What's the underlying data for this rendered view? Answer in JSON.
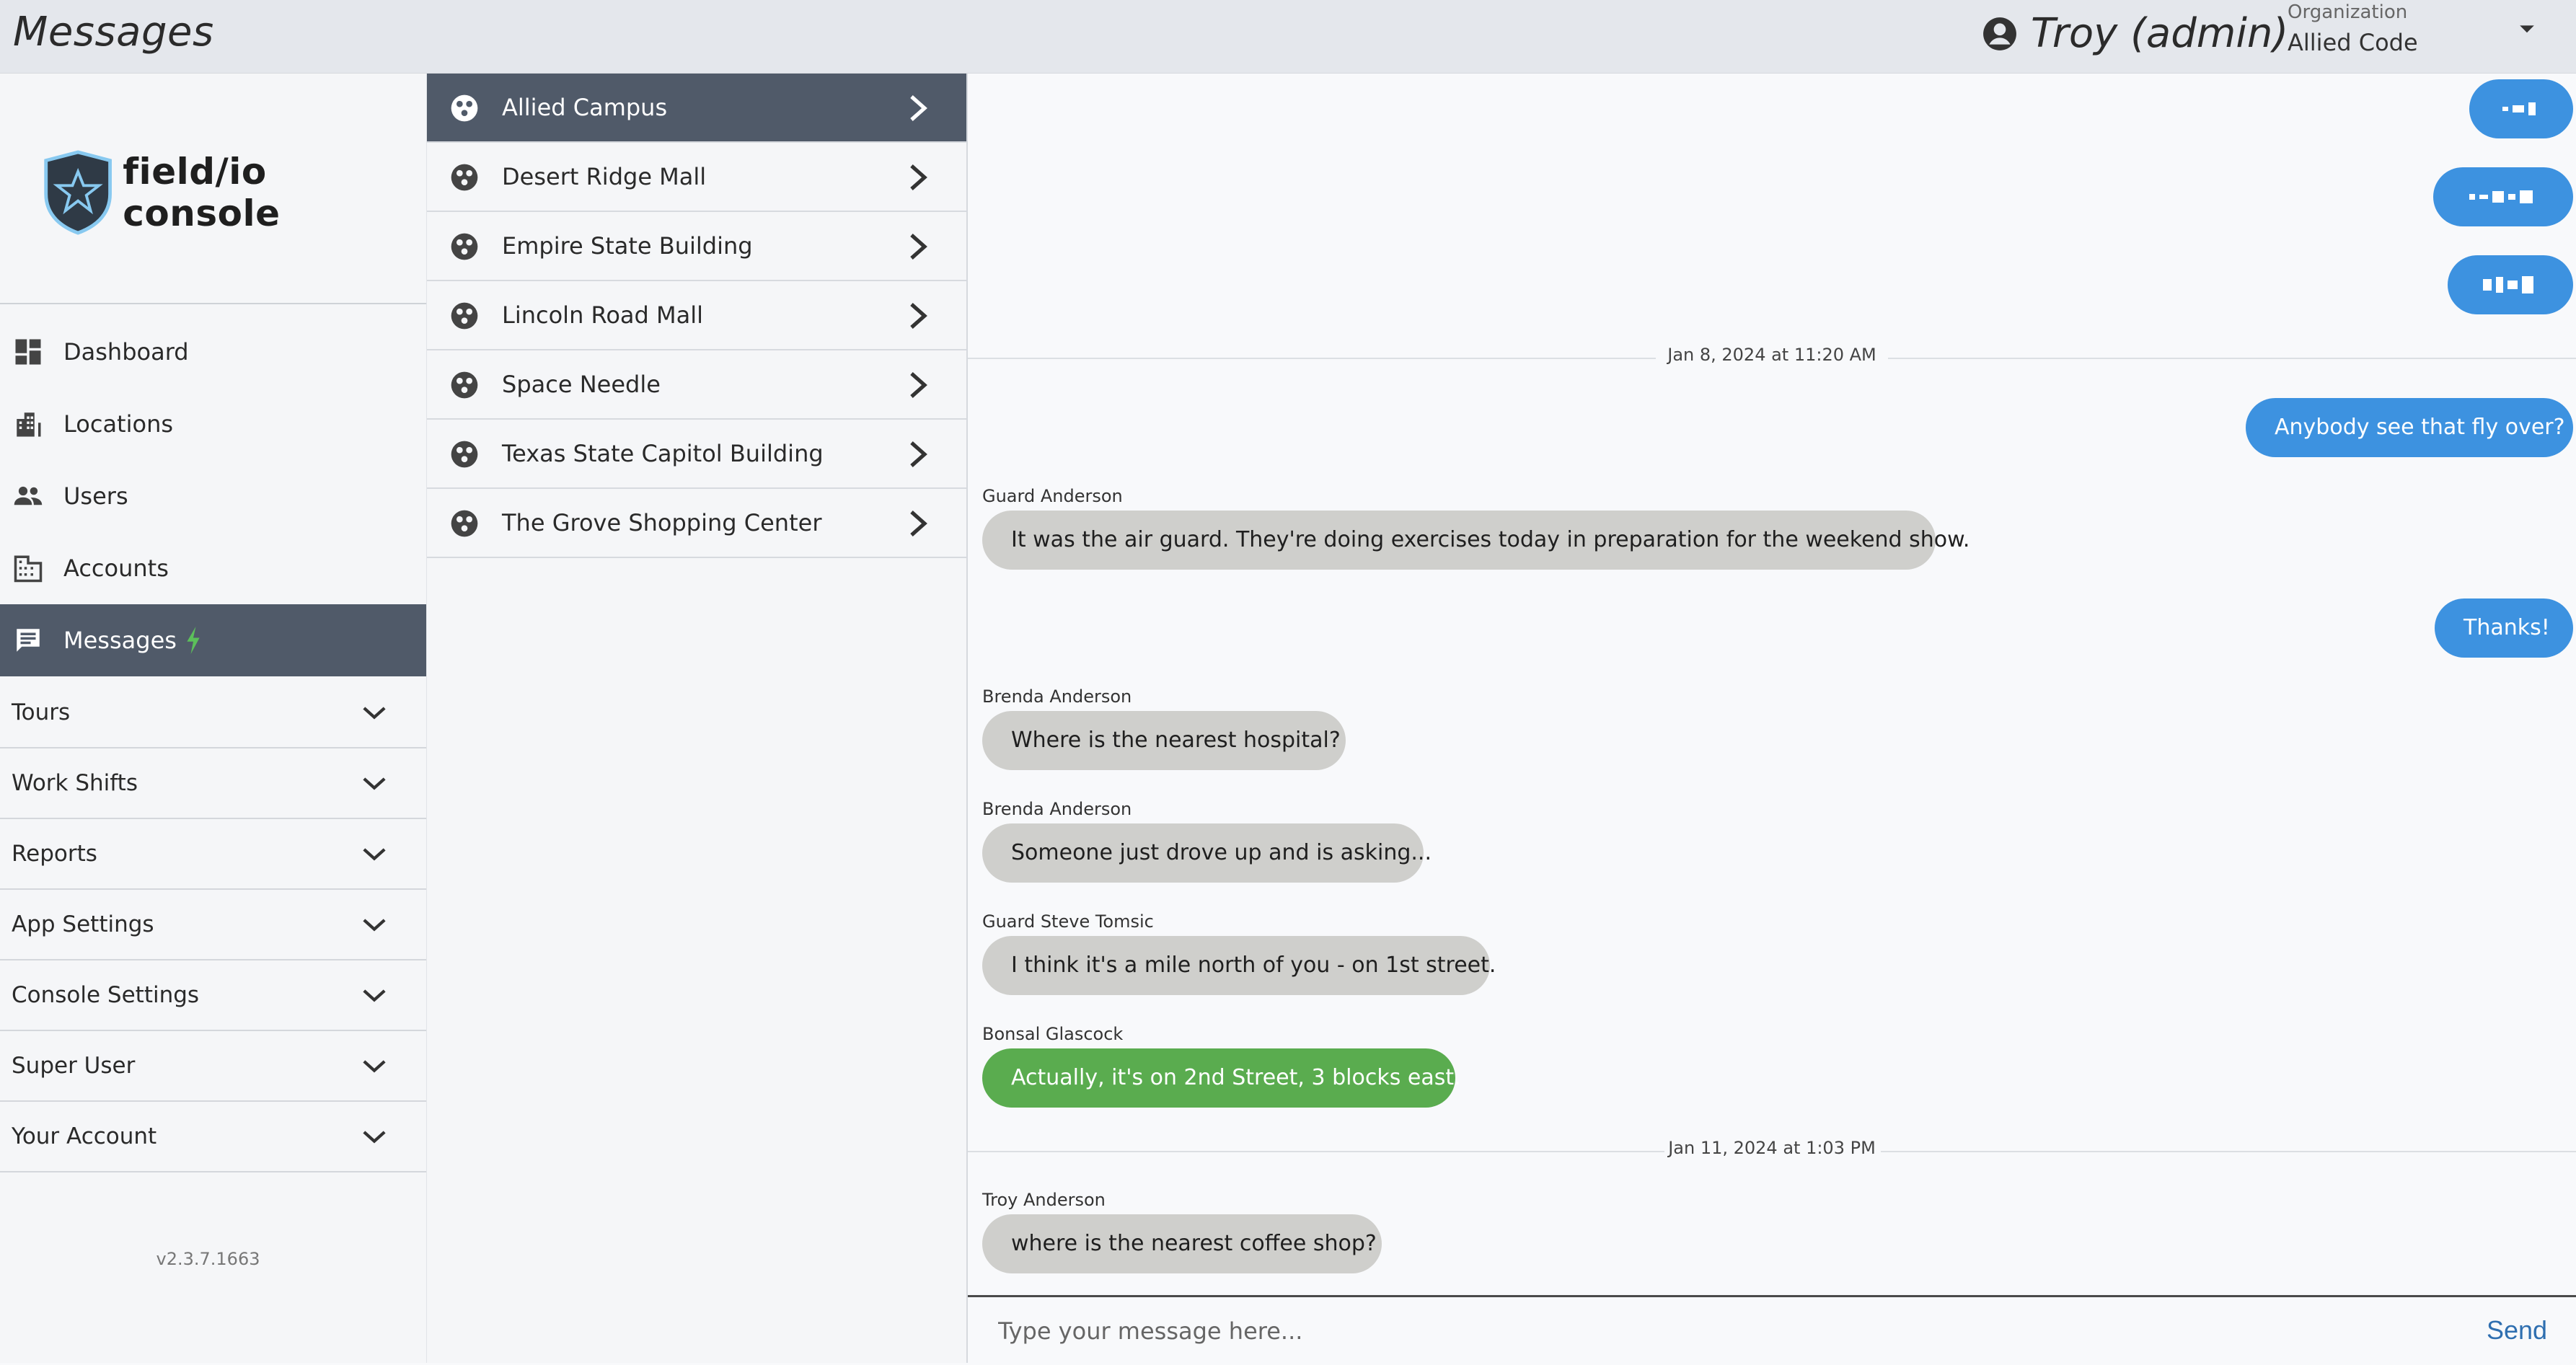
{
  "header": {
    "title": "Messages",
    "user": "Troy (admin)",
    "org_label": "Organization",
    "org_value": "Allied Code"
  },
  "brand": {
    "name": "field/io console"
  },
  "nav": {
    "items": [
      {
        "label": "Dashboard",
        "icon": "dashboard-icon"
      },
      {
        "label": "Locations",
        "icon": "building-icon"
      },
      {
        "label": "Users",
        "icon": "users-icon"
      },
      {
        "label": "Accounts",
        "icon": "accounts-icon"
      },
      {
        "label": "Messages",
        "icon": "chat-icon",
        "active": true,
        "badge_icon": "bolt-icon"
      }
    ],
    "sections": [
      "Tours",
      "Work Shifts",
      "Reports",
      "App Settings",
      "Console Settings",
      "Super User",
      "Your Account"
    ],
    "version": "v2.3.7.1663"
  },
  "locations": [
    {
      "label": "Allied Campus",
      "active": true
    },
    {
      "label": "Desert Ridge Mall"
    },
    {
      "label": "Empire State Building"
    },
    {
      "label": "Lincoln Road Mall"
    },
    {
      "label": "Space Needle"
    },
    {
      "label": "Texas State Capitol Building"
    },
    {
      "label": "The Grove Shopping Center"
    }
  ],
  "messages": {
    "date1": "Jan 8, 2024 at 11:20 AM",
    "date2": "Jan 11, 2024 at 1:03 PM",
    "m1": "Anybody see that fly over?",
    "s2": "Guard Anderson",
    "m2": "It was the air guard.  They're doing exercises today in preparation for the weekend show.",
    "m3": "Thanks!",
    "s4": "Brenda Anderson",
    "m4": "Where is the nearest hospital?",
    "s5": "Brenda Anderson",
    "m5": "Someone just drove up and is asking...",
    "s6": "Guard Steve Tomsic",
    "m6": "I think it's a mile north of you - on 1st street.",
    "s7": "Bonsal Glascock",
    "m7": "Actually, it's on 2nd Street, 3 blocks east.",
    "s8": "Troy Anderson",
    "m8": "where is the nearest coffee shop?"
  },
  "composer": {
    "placeholder": "Type your message here...",
    "send": "Send"
  },
  "colors": {
    "mine": "#3d92e0",
    "other": "#cfcfcc",
    "highlight": "#5aac4f",
    "nav_active": "#505a69"
  }
}
